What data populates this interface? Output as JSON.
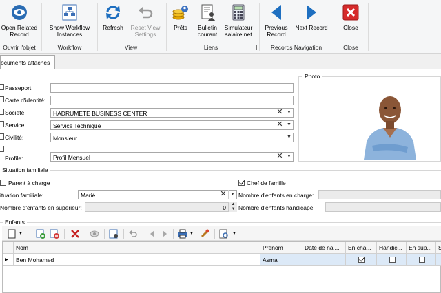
{
  "ribbon": {
    "buttons": [
      {
        "label": "Open Related Record",
        "icon": "eye-icon"
      },
      {
        "label": "Show Workflow Instances",
        "icon": "workflow-icon"
      },
      {
        "label": "Refresh",
        "icon": "refresh-icon"
      },
      {
        "label": "Reset View Settings",
        "icon": "reset-icon",
        "disabled": true
      },
      {
        "label": "Prêts",
        "icon": "coins-icon"
      },
      {
        "label": "Bulletin courant",
        "icon": "document-user-icon"
      },
      {
        "label": "Simulateur salaire net",
        "icon": "calculator-icon"
      },
      {
        "label": "Previous Record",
        "icon": "arrow-left-icon"
      },
      {
        "label": "Next Record",
        "icon": "arrow-right-icon"
      },
      {
        "label": "Close",
        "icon": "close-red-icon"
      }
    ],
    "groups": {
      "ouvrir": "Ouvrir l'objet",
      "workflow": "Workflow",
      "view": "View",
      "liens": "Liens",
      "records": "Records Navigation",
      "close": "Close"
    }
  },
  "tab": {
    "label": "ocuments attachés"
  },
  "form": {
    "passeport": {
      "label": "Passeport:",
      "value": ""
    },
    "carte": {
      "label": "Carte d'identité:",
      "value": ""
    },
    "societe": {
      "label": "Société:",
      "value": "HADRUMETE BUSINESS CENTER"
    },
    "service": {
      "label": "Service:",
      "value": "Service Technique"
    },
    "civilite": {
      "label": "Civilité:",
      "value": "Monsieur"
    },
    "profile": {
      "label": "Profile:",
      "value": "Profil Mensuel"
    },
    "photo_title": "Photo"
  },
  "situation": {
    "title": "Situation familiale",
    "parent_a_charge": {
      "label": "Parent à charge",
      "checked": false
    },
    "chef_de_famille": {
      "label": "Chef de famille",
      "checked": true
    },
    "situation_familiale": {
      "label": "ituation familiale:",
      "value": "Marié"
    },
    "enfants_en_charge": {
      "label": "Nombre d'enfants en charge:",
      "value": ""
    },
    "enfants_superieur": {
      "label": "Nombre d'enfants en supérieur:",
      "value": "0"
    },
    "enfants_handicape": {
      "label": "Nombre d'enfants handicapé:",
      "value": ""
    }
  },
  "enfants": {
    "title": "Enfants",
    "columns": [
      "Nom",
      "Prénom",
      "Date de nai...",
      "En cha...",
      "Handic...",
      "En sup...",
      "S"
    ],
    "rows": [
      {
        "nom": "Ben Mohamed",
        "prenom": "Asma",
        "date": "",
        "en_charge": true,
        "handicape": false,
        "en_sup": false
      }
    ]
  },
  "colors": {
    "accent": "#1e6fc0",
    "selection": "#dce9f7",
    "close_red": "#d62b2b"
  }
}
